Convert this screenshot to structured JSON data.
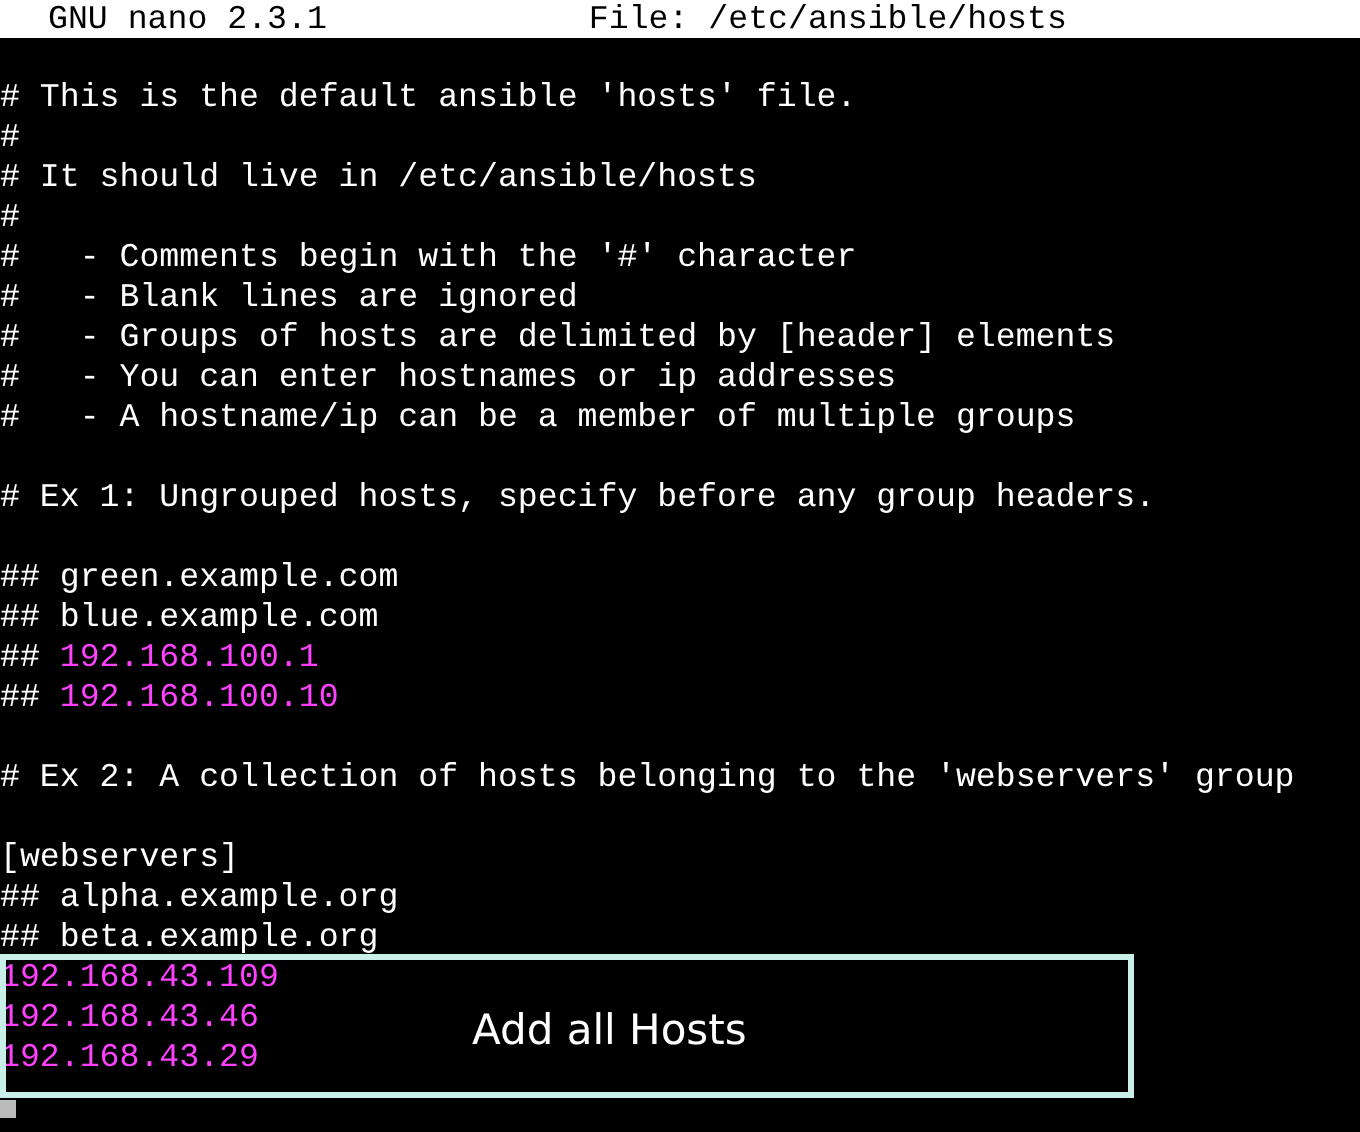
{
  "title_bar": {
    "app": "GNU nano 2.3.1",
    "file": "File: /etc/ansible/hosts"
  },
  "lines": [
    {
      "kind": "blank"
    },
    {
      "kind": "text",
      "segments": [
        {
          "kind": "plain",
          "text": "# This is the default ansible 'hosts' file."
        }
      ]
    },
    {
      "kind": "text",
      "segments": [
        {
          "kind": "plain",
          "text": "#"
        }
      ]
    },
    {
      "kind": "text",
      "segments": [
        {
          "kind": "plain",
          "text": "# It should live in /etc/ansible/hosts"
        }
      ]
    },
    {
      "kind": "text",
      "segments": [
        {
          "kind": "plain",
          "text": "#"
        }
      ]
    },
    {
      "kind": "text",
      "segments": [
        {
          "kind": "plain",
          "text": "#   - Comments begin with the '#' character"
        }
      ]
    },
    {
      "kind": "text",
      "segments": [
        {
          "kind": "plain",
          "text": "#   - Blank lines are ignored"
        }
      ]
    },
    {
      "kind": "text",
      "segments": [
        {
          "kind": "plain",
          "text": "#   - Groups of hosts are delimited by [header] elements"
        }
      ]
    },
    {
      "kind": "text",
      "segments": [
        {
          "kind": "plain",
          "text": "#   - You can enter hostnames or ip addresses"
        }
      ]
    },
    {
      "kind": "text",
      "segments": [
        {
          "kind": "plain",
          "text": "#   - A hostname/ip can be a member of multiple groups"
        }
      ]
    },
    {
      "kind": "blank"
    },
    {
      "kind": "text",
      "segments": [
        {
          "kind": "plain",
          "text": "# Ex 1: Ungrouped hosts, specify before any group headers."
        }
      ]
    },
    {
      "kind": "blank"
    },
    {
      "kind": "text",
      "segments": [
        {
          "kind": "plain",
          "text": "## green.example.com"
        }
      ]
    },
    {
      "kind": "text",
      "segments": [
        {
          "kind": "plain",
          "text": "## blue.example.com"
        }
      ]
    },
    {
      "kind": "text",
      "segments": [
        {
          "kind": "plain",
          "text": "## "
        },
        {
          "kind": "ip",
          "text": "192.168.100.1"
        }
      ]
    },
    {
      "kind": "text",
      "segments": [
        {
          "kind": "plain",
          "text": "## "
        },
        {
          "kind": "ip",
          "text": "192.168.100.10"
        }
      ]
    },
    {
      "kind": "blank"
    },
    {
      "kind": "text",
      "segments": [
        {
          "kind": "plain",
          "text": "# Ex 2: A collection of hosts belonging to the 'webservers' group"
        }
      ]
    },
    {
      "kind": "blank"
    },
    {
      "kind": "text",
      "segments": [
        {
          "kind": "plain",
          "text": "[webservers]"
        }
      ]
    },
    {
      "kind": "text",
      "segments": [
        {
          "kind": "plain",
          "text": "## alpha.example.org"
        }
      ]
    },
    {
      "kind": "text",
      "segments": [
        {
          "kind": "plain",
          "text": "## beta.example.org"
        }
      ]
    },
    {
      "kind": "text",
      "segments": [
        {
          "kind": "ip",
          "text": "192.168.43.109"
        }
      ]
    },
    {
      "kind": "text",
      "segments": [
        {
          "kind": "ip",
          "text": "192.168.43.46"
        }
      ]
    },
    {
      "kind": "text",
      "segments": [
        {
          "kind": "ip",
          "text": "192.168.43.29"
        }
      ]
    }
  ],
  "callout": {
    "label": "Add all Hosts"
  }
}
